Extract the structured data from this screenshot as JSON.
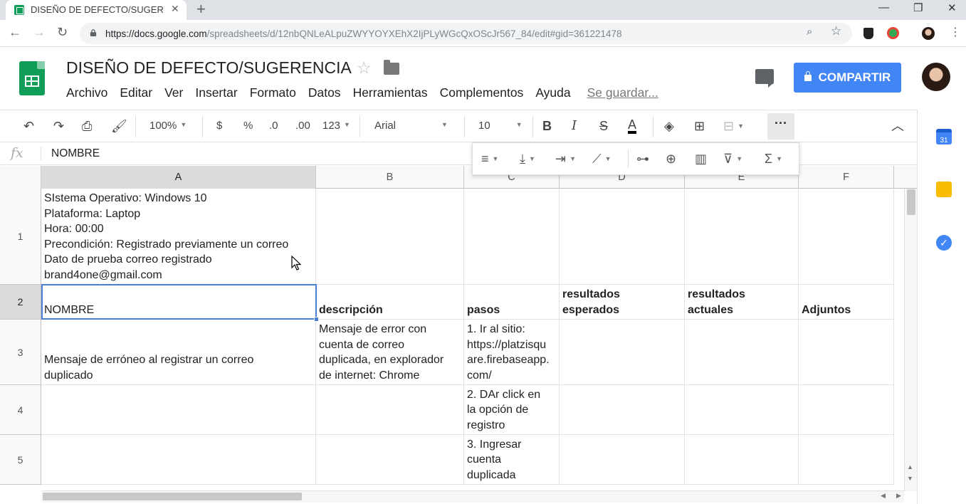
{
  "browser": {
    "tab_title": "DISEÑO DE DEFECTO/SUGERENC",
    "tab_close": "✕",
    "new_tab": "+",
    "url_host": "https://docs.google.com",
    "url_path": "/spreadsheets/d/12nbQNLeALpuZWYYOYXEhX2IjPLyWGcQxOScJr567_84/edit#gid=361221478"
  },
  "doc": {
    "title": "DISEÑO DE DEFECTO/SUGERENCIA",
    "menu": [
      "Archivo",
      "Editar",
      "Ver",
      "Insertar",
      "Formato",
      "Datos",
      "Herramientas",
      "Complementos",
      "Ayuda"
    ],
    "save_status": "Se guardar...",
    "share_label": "COMPARTIR"
  },
  "toolbar": {
    "zoom": "100%",
    "currency": "$",
    "percent": "%",
    "dec_less": ".0",
    "dec_more": ".00",
    "format_more": "123",
    "font": "Arial",
    "font_size": "10",
    "bold": "B",
    "italic": "I",
    "strike": "S",
    "text_color": "A"
  },
  "formula_bar": {
    "fx": "fx",
    "value": "NOMBRE"
  },
  "columns": [
    "A",
    "B",
    "C",
    "D",
    "E",
    "F"
  ],
  "rows": [
    {
      "num": "1",
      "cells": [
        [
          "SIstema Operativo: Windows 10",
          "Plataforma: Laptop",
          "Hora: 00:00",
          "Precondición: Registrado previamente un correo",
          "Dato de prueba correo registrado",
          "brand4one@gmail.com"
        ],
        [],
        [],
        [],
        [],
        []
      ]
    },
    {
      "num": "2",
      "cells": [
        [
          "NOMBRE"
        ],
        [
          "descripción"
        ],
        [
          "pasos"
        ],
        [
          "resultados",
          "esperados"
        ],
        [
          "resultados",
          "actuales"
        ],
        [
          "Adjuntos"
        ]
      ]
    },
    {
      "num": "3",
      "cells": [
        [
          "Mensaje de erróneo al registrar un correo",
          "duplicado"
        ],
        [
          "Mensaje de error con",
          "cuenta de correo",
          "duplicada, en explorador",
          "de internet: Chrome"
        ],
        [
          "1. Ir al sitio:",
          "https://platzisqu",
          "are.firebaseapp.",
          "com/"
        ],
        [],
        [],
        []
      ]
    },
    {
      "num": "4",
      "cells": [
        [],
        [],
        [
          "2. DAr click en",
          "la opción de",
          "registro"
        ],
        [],
        [],
        []
      ]
    },
    {
      "num": "5",
      "cells": [
        [],
        [],
        [
          "3. Ingresar",
          "cuenta",
          "duplicada"
        ],
        [],
        [],
        []
      ]
    }
  ],
  "colors": {
    "accent": "#4285f4",
    "selection": "#4a7fd6",
    "sheets_green": "#0f9d58"
  }
}
